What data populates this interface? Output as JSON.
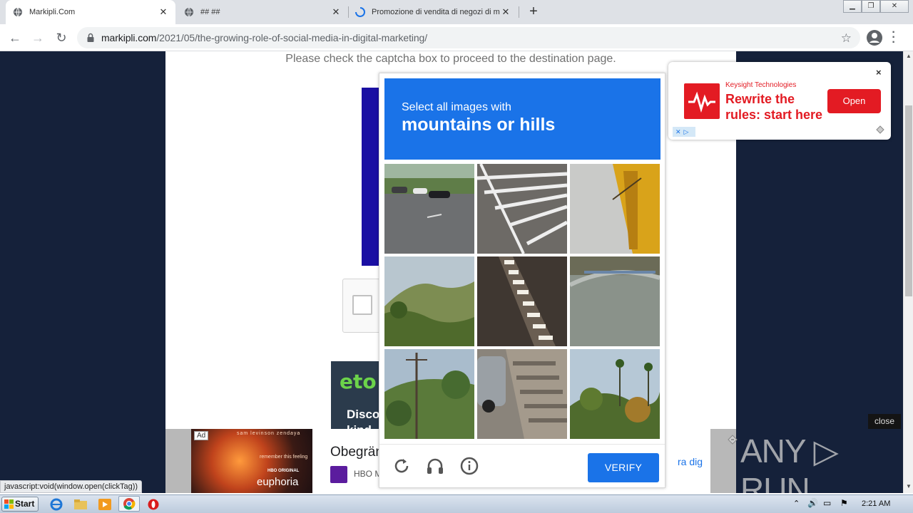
{
  "browser": {
    "tabs": [
      {
        "title": "Markipli.Com",
        "active": true
      },
      {
        "title": "## ##",
        "active": false
      },
      {
        "title": "Promozione di vendita di negozi di m",
        "active": false
      }
    ],
    "new_tab_label": "+",
    "url_host": "markipli.com",
    "url_path": "/2021/05/the-growing-role-of-social-media-in-digital-marketing/",
    "status_link": "javascript:void(window.open(clickTag))"
  },
  "page": {
    "notice": "Please check the captcha box to proceed to the destination page.",
    "etoro_logo": "eto",
    "etoro_text_1": "Disco",
    "etoro_text_2": "kind"
  },
  "captcha": {
    "prompt_line1": "Select all images with",
    "prompt_line2": "mountains or hills",
    "verify_label": "VERIFY",
    "tiles": [
      {
        "scene": "street with parked cars"
      },
      {
        "scene": "road crosswalk markings"
      },
      {
        "scene": "yellow pole and sky"
      },
      {
        "scene": "green hill with trees"
      },
      {
        "scene": "road shadow stripes"
      },
      {
        "scene": "curb and pavement"
      },
      {
        "scene": "trees and utility pole"
      },
      {
        "scene": "car and crosswalk"
      },
      {
        "scene": "trees and palm trees"
      }
    ]
  },
  "ad_top_right": {
    "brand": "Keysight Technologies",
    "headline_1": "Rewrite the",
    "headline_2": "rules: start here",
    "cta": "Open",
    "close": "×",
    "color": "#e31b23"
  },
  "ad_bottom": {
    "ad_label": "Ad",
    "tagline_top": "sam levinson   zendaya",
    "tagline_mid": "remember this feeling",
    "network": "HBO ORIGINAL",
    "show": "euphoria",
    "title": "Obegrän",
    "advertiser": "HBO M",
    "link": "ra dig"
  },
  "overlay": {
    "close_label": "close",
    "watermark": "ANY ▷ RUN"
  },
  "taskbar": {
    "start_label": "Start",
    "clock": "2:21 AM"
  }
}
